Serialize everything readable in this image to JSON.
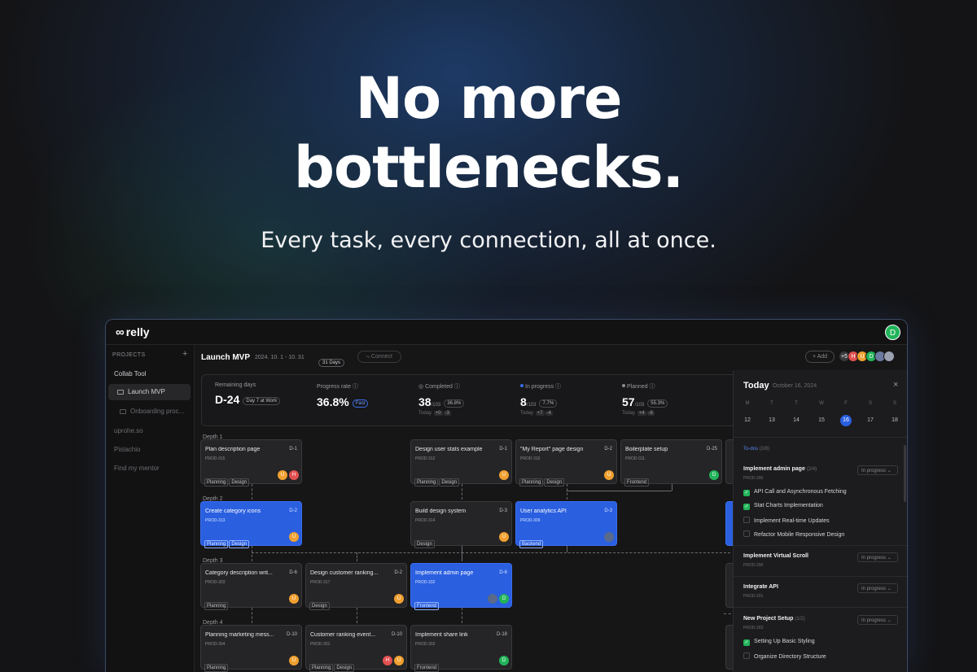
{
  "hero": {
    "line1": "No more",
    "line2": "bottlenecks.",
    "subtitle": "Every task, every connection, all at once."
  },
  "app": {
    "logo": "relly",
    "logo_icon": "infinity-icon",
    "me_initial": "D",
    "sidebar": {
      "header": "PROJECTS",
      "add": "+",
      "items": [
        {
          "label": "Collab Tool"
        },
        {
          "label": "Launch MVP"
        },
        {
          "label": "Onboarding proc..."
        },
        {
          "label": "uprohe.so"
        },
        {
          "label": "Pistachio"
        },
        {
          "label": "Find my mentor"
        }
      ]
    },
    "header": {
      "title": "Launch MVP",
      "dates": "2024. 10. 1 - 10. 31",
      "days": "31 Days",
      "connect": "Connect",
      "add": "Add",
      "more": "+5",
      "avatars": [
        {
          "i": "H",
          "color": "#e25050"
        },
        {
          "i": "U",
          "color": "#f0a030"
        },
        {
          "i": "D",
          "color": "#22b45a"
        },
        {
          "i": "",
          "color": "#6a7aa0"
        },
        {
          "i": "",
          "color": "#9aa0b0"
        }
      ]
    },
    "stats": [
      {
        "label": "Remaining days",
        "value": "D-24",
        "tag": "Day 7 at Work"
      },
      {
        "label": "Progress rate",
        "value": "36.8%",
        "tag": "Fast"
      },
      {
        "label": "Completed",
        "value": "38",
        "total": "/103",
        "tag": "36.8%",
        "today_label": "Today",
        "today_a": "+0",
        "today_b": "-3"
      },
      {
        "label": "In progress",
        "value": "8",
        "total": "/103",
        "tag": "7.7%",
        "today_label": "Today",
        "today_a": "+7",
        "today_b": "-4"
      },
      {
        "label": "Planned",
        "value": "57",
        "total": "/103",
        "tag": "55.3%",
        "today_label": "Today",
        "today_a": "+4",
        "today_b": "-8"
      }
    ],
    "depths": [
      "Depth 1",
      "Depth 2",
      "Depth 3",
      "Depth 4"
    ],
    "cards": [
      {
        "title": "Plan description page",
        "d": "D-1",
        "id": "PROD-315",
        "tags": [
          "Planning",
          "Design"
        ],
        "blue": false,
        "avatars": [
          "U",
          "H"
        ]
      },
      {
        "title": "Design user stats example",
        "d": "D-1",
        "id": "PROD-312",
        "tags": [
          "Planning",
          "Design"
        ],
        "blue": false,
        "avatars": [
          "U"
        ]
      },
      {
        "title": "\"My Report\" page design",
        "d": "D-2",
        "id": "PROD-310",
        "tags": [
          "Planning",
          "Design"
        ],
        "blue": false,
        "avatars": [
          "U"
        ]
      },
      {
        "title": "Boilerplate setup",
        "d": "D-25",
        "id": "PROD-311",
        "tags": [
          "Frontend"
        ],
        "blue": false,
        "avatars": [
          "D"
        ]
      },
      {
        "title": "Create category icons",
        "d": "D-2",
        "id": "PROD-313",
        "tags": [
          "Planning",
          "Design"
        ],
        "blue": true,
        "avatars": [
          "U"
        ]
      },
      {
        "title": "Build design system",
        "d": "D-3",
        "id": "PROD-314",
        "tags": [
          "Design"
        ],
        "blue": false,
        "avatars": [
          "U"
        ]
      },
      {
        "title": "User analytics API",
        "d": "D-3",
        "id": "PROD-309",
        "tags": [
          "Backend"
        ],
        "blue": true,
        "avatars": [
          ""
        ]
      },
      {
        "title": "Category description writ...",
        "d": "D-6",
        "id": "PROD-303",
        "tags": [
          "Planning"
        ],
        "blue": false,
        "avatars": [
          "U"
        ]
      },
      {
        "title": "Design customer ranking...",
        "d": "D-2",
        "id": "PROD-317",
        "tags": [
          "Design"
        ],
        "blue": false,
        "avatars": [
          "U"
        ]
      },
      {
        "title": "Implement admin page",
        "d": "D-6",
        "id": "PROD-332",
        "tags": [
          "Frontend"
        ],
        "blue": true,
        "avatars": [
          "",
          "D"
        ]
      },
      {
        "title": "Planning marketing mess...",
        "d": "D-10",
        "id": "PROD-304",
        "tags": [
          "Planning"
        ],
        "blue": false,
        "avatars": [
          "U"
        ]
      },
      {
        "title": "Customer ranking event...",
        "d": "D-10",
        "id": "PROD-301",
        "tags": [
          "Planning",
          "Design"
        ],
        "blue": false,
        "avatars": [
          "H",
          "U"
        ]
      },
      {
        "title": "Implement share link",
        "d": "D-18",
        "id": "PROD-302",
        "tags": [
          "Frontend"
        ],
        "blue": false,
        "avatars": [
          "D"
        ]
      }
    ],
    "calendar": {
      "title": "Today",
      "date": "October 16, 2024",
      "close": "×",
      "weekdays": [
        "M",
        "T",
        "T",
        "W",
        "F",
        "S",
        "S"
      ],
      "days": [
        "12",
        "13",
        "14",
        "15",
        "16",
        "17",
        "18"
      ],
      "todo_label": "To-dos",
      "todo_count": "(3/8)",
      "tasks": [
        {
          "title": "Implement admin page",
          "count": "(2/4)",
          "id": "PROD-296",
          "status": "In progress",
          "subs": [
            {
              "label": "API Call and Asynchronous Fetching",
              "done": true
            },
            {
              "label": "Stat Charts Implementation",
              "done": true
            },
            {
              "label": "Implement Real-time Updates",
              "done": false
            },
            {
              "label": "Refactor Mobile Responsive Design",
              "done": false
            }
          ]
        },
        {
          "title": "Implement Virtual Scroll",
          "count": "",
          "id": "PROD-290",
          "status": "In progress",
          "subs": []
        },
        {
          "title": "Integrate API",
          "count": "",
          "id": "PROD-291",
          "status": "In progress",
          "subs": []
        },
        {
          "title": "New Project Setup",
          "count": "(1/2)",
          "id": "PROD-283",
          "status": "In progress",
          "subs": [
            {
              "label": "Setting Up Basic Styling",
              "done": true
            },
            {
              "label": "Organize Directory Structure",
              "done": false
            }
          ]
        }
      ]
    }
  }
}
